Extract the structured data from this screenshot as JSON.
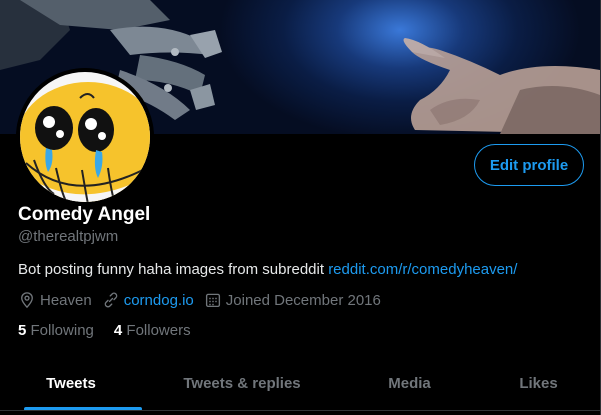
{
  "profile": {
    "name": "Comedy Angel",
    "handle": "@therealtpjwm",
    "bio_text": "Bot posting funny haha images from subreddit ",
    "bio_link": "reddit.com/r/comedyheaven/",
    "location": "Heaven",
    "website": "corndog.io",
    "joined": "Joined December 2016",
    "following_count": "5",
    "following_label": "Following",
    "followers_count": "4",
    "followers_label": "Followers"
  },
  "actions": {
    "edit_profile": "Edit profile"
  },
  "tabs": [
    {
      "label": "Tweets",
      "active": true
    },
    {
      "label": "Tweets & replies",
      "active": false
    },
    {
      "label": "Media",
      "active": false
    },
    {
      "label": "Likes",
      "active": false
    }
  ],
  "colors": {
    "accent": "#1d9bf0",
    "background": "#000000",
    "secondary_text": "#71767b"
  },
  "icons": [
    "location-pin-icon",
    "link-icon",
    "calendar-icon"
  ]
}
